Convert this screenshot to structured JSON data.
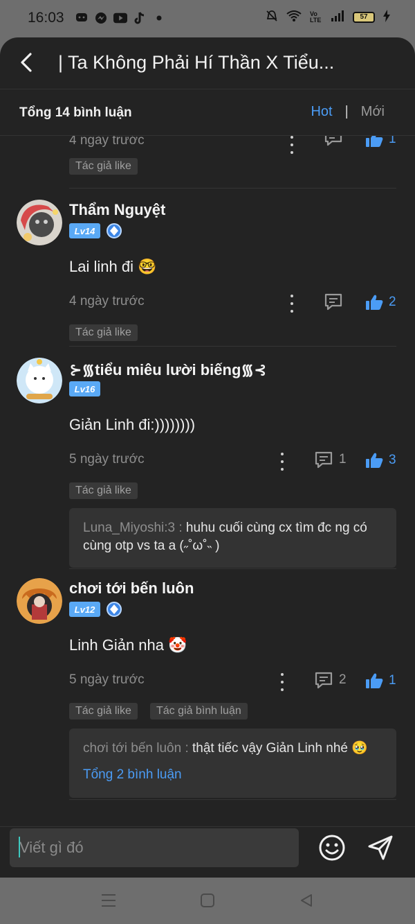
{
  "status_bar": {
    "time": "16:03",
    "left_icons": [
      "chat-bubble-icon",
      "messenger-icon",
      "youtube-icon",
      "tiktok-icon",
      "dot-icon"
    ],
    "right_icons": [
      "mute-icon",
      "wifi-icon",
      "volte-icon",
      "signal-icon"
    ],
    "volte_label": "Vo LTE",
    "battery": "57"
  },
  "header": {
    "title": "| Ta Không Phải Hí Thần X Tiểu..."
  },
  "subheader": {
    "total": "Tổng 14 bình luận",
    "sort_hot": "Hot",
    "sort_separator": "|",
    "sort_new": "Mới"
  },
  "comments": [
    {
      "time": "4 ngày trước",
      "likes": "1",
      "tags": [
        "Tác giả like"
      ]
    },
    {
      "name": "Thẩm Nguyệt",
      "level": "Lv14",
      "text": "Lai linh đi 🤓",
      "time": "4 ngày trước",
      "likes": "2",
      "tags": [
        "Tác giả like"
      ]
    },
    {
      "name": "⊱᯾tiểu miêu lười biếng᯾⊰",
      "level": "Lv16",
      "text": "Giản Linh đi:))))))))",
      "time": "5 ngày trước",
      "replies": "1",
      "likes": "3",
      "tags": [
        "Tác giả like"
      ],
      "reply_preview": {
        "name": "Luna_Miyoshi:3 :",
        "text": " huhu cuối cùng cx tìm đc ng có cùng otp vs ta a (˶˚ω˚˵ )"
      }
    },
    {
      "name": "chơi tới bến luôn",
      "level": "Lv12",
      "text": "Linh Giản nha 🤡",
      "time": "5 ngày trước",
      "replies": "2",
      "likes": "1",
      "tags": [
        "Tác giả like",
        "Tác giả bình luận"
      ],
      "reply_preview": {
        "name": "chơi tới bến luôn :",
        "text": " thật tiếc vậy Giản Linh nhé 🥹",
        "more": "Tổng 2 bình luận"
      }
    }
  ],
  "input": {
    "placeholder": "Viết gì đó"
  },
  "colors": {
    "accent": "#4b9cf5",
    "background": "#232323",
    "level_badge": "#5aa9f5"
  }
}
